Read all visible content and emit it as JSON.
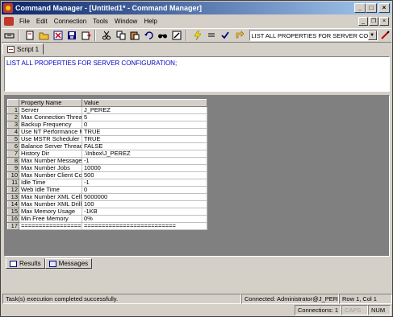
{
  "window": {
    "title": "Command Manager - [Untitled1* - Command Manager]",
    "min": "_",
    "max": "□",
    "close": "×"
  },
  "menu": {
    "items": [
      "File",
      "Edit",
      "Connection",
      "Tools",
      "Window",
      "Help"
    ],
    "mdi_min": "_",
    "mdi_restore": "❐",
    "mdi_close": "×"
  },
  "toolbar": {
    "combo_value": "LIST ALL PROPERTIES FOR SERVER CONFIGU",
    "combo_arrow": "▼",
    "icons": [
      "connect-icon",
      "new-icon",
      "open-icon",
      "close-icon",
      "save-icon",
      "export-icon",
      "cut-icon",
      "copy-icon",
      "paste-icon",
      "undo-icon",
      "find-icon",
      "edit-icon",
      "execute-icon",
      "stop-icon",
      "check-icon",
      "refresh-icon",
      "clear-icon"
    ]
  },
  "script_tab": {
    "label": "Script 1"
  },
  "editor": {
    "text": "LIST ALL PROPERTIES FOR SERVER CONFIGURATION;"
  },
  "grid": {
    "headers": [
      "Property Name",
      "Value"
    ],
    "rows": [
      {
        "n": "1",
        "name": "Server",
        "value": "J_PEREZ"
      },
      {
        "n": "2",
        "name": "Max Connection Thread",
        "value": "5"
      },
      {
        "n": "3",
        "name": "Backup Frequency",
        "value": "0"
      },
      {
        "n": "4",
        "name": "Use NT Performance Mc",
        "value": "TRUE"
      },
      {
        "n": "5",
        "name": "Use MSTR Scheduler",
        "value": "TRUE"
      },
      {
        "n": "6",
        "name": "Balance Server Threads",
        "value": "FALSE"
      },
      {
        "n": "7",
        "name": "History Dir",
        "value": ".\\Inbox\\J_PEREZ"
      },
      {
        "n": "8",
        "name": "Max Number Messages",
        "value": "-1"
      },
      {
        "n": "9",
        "name": "Max Number Jobs",
        "value": "10000"
      },
      {
        "n": "10",
        "name": "Max Number Client Conn",
        "value": "500"
      },
      {
        "n": "11",
        "name": "Idle Time",
        "value": "-1"
      },
      {
        "n": "12",
        "name": "Web Idle Time",
        "value": "0"
      },
      {
        "n": "13",
        "name": "Max Number XML Cells",
        "value": "5000000"
      },
      {
        "n": "14",
        "name": "Max Number XML Drill P",
        "value": "100"
      },
      {
        "n": "15",
        "name": "Max Memory Usage",
        "value": "-1KB"
      },
      {
        "n": "16",
        "name": "Min Free Memory",
        "value": "0%"
      },
      {
        "n": "17",
        "name": "=====================",
        "value": "=========================="
      }
    ]
  },
  "result_tabs": {
    "results": "Results",
    "messages": "Messages"
  },
  "status": {
    "message": "Task(s) execution completed successfully.",
    "connected": "Connected: Administrator@J_PEREZ",
    "position": "Row 1, Col 1",
    "connections": "Connections: 1",
    "caps": "CAPS",
    "num": "NUM"
  }
}
